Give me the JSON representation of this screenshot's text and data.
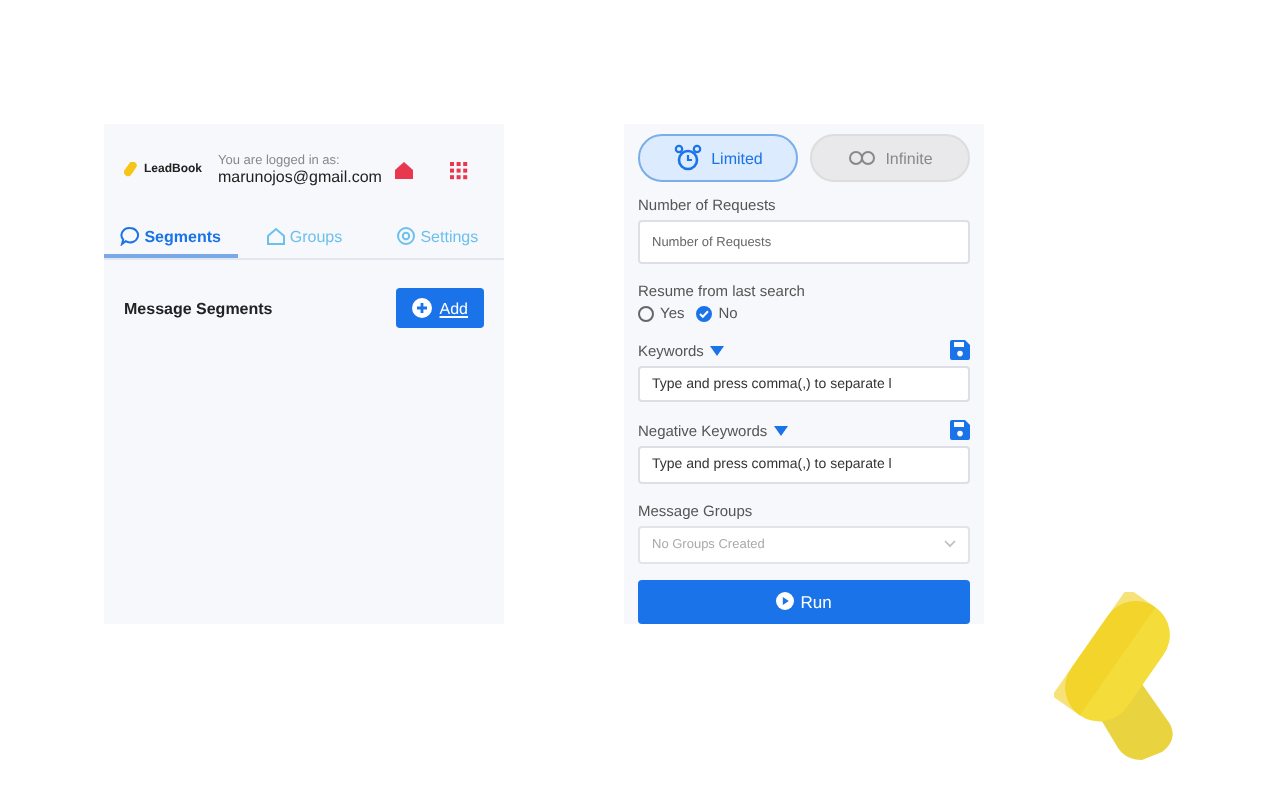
{
  "left_panel": {
    "header": {
      "brand": "LeadBook",
      "login_note": "You are logged in as:",
      "email": "marunojos@gmail.com"
    },
    "tabs": [
      {
        "label": "Segments",
        "kind": "chat",
        "selected": true
      },
      {
        "label": "Groups",
        "kind": "home",
        "selected": false
      },
      {
        "label": "Settings",
        "kind": "gear",
        "selected": false
      }
    ],
    "section_title": "Message Segments",
    "add_button": "Add"
  },
  "right_panel": {
    "modes": [
      {
        "label": "Limited",
        "kind": "alarm",
        "selected": true
      },
      {
        "label": "Infinite",
        "kind": "infinity",
        "selected": false
      }
    ],
    "requests": {
      "label": "Number of Requests",
      "placeholder": "Number of Requests"
    },
    "resume": {
      "label": "Resume from last search",
      "options": [
        {
          "label": "Yes",
          "selected": false
        },
        {
          "label": "No",
          "selected": true
        }
      ]
    },
    "keywords": {
      "label": "Keywords",
      "placeholder": "Type and press comma(,) to separate l"
    },
    "negative_keywords": {
      "label": "Negative Keywords",
      "placeholder": "Type and press comma(,) to separate l"
    },
    "message_groups": {
      "label": "Message Groups",
      "value": "No Groups Created",
      "disabled": true
    },
    "run_button": "Run"
  }
}
